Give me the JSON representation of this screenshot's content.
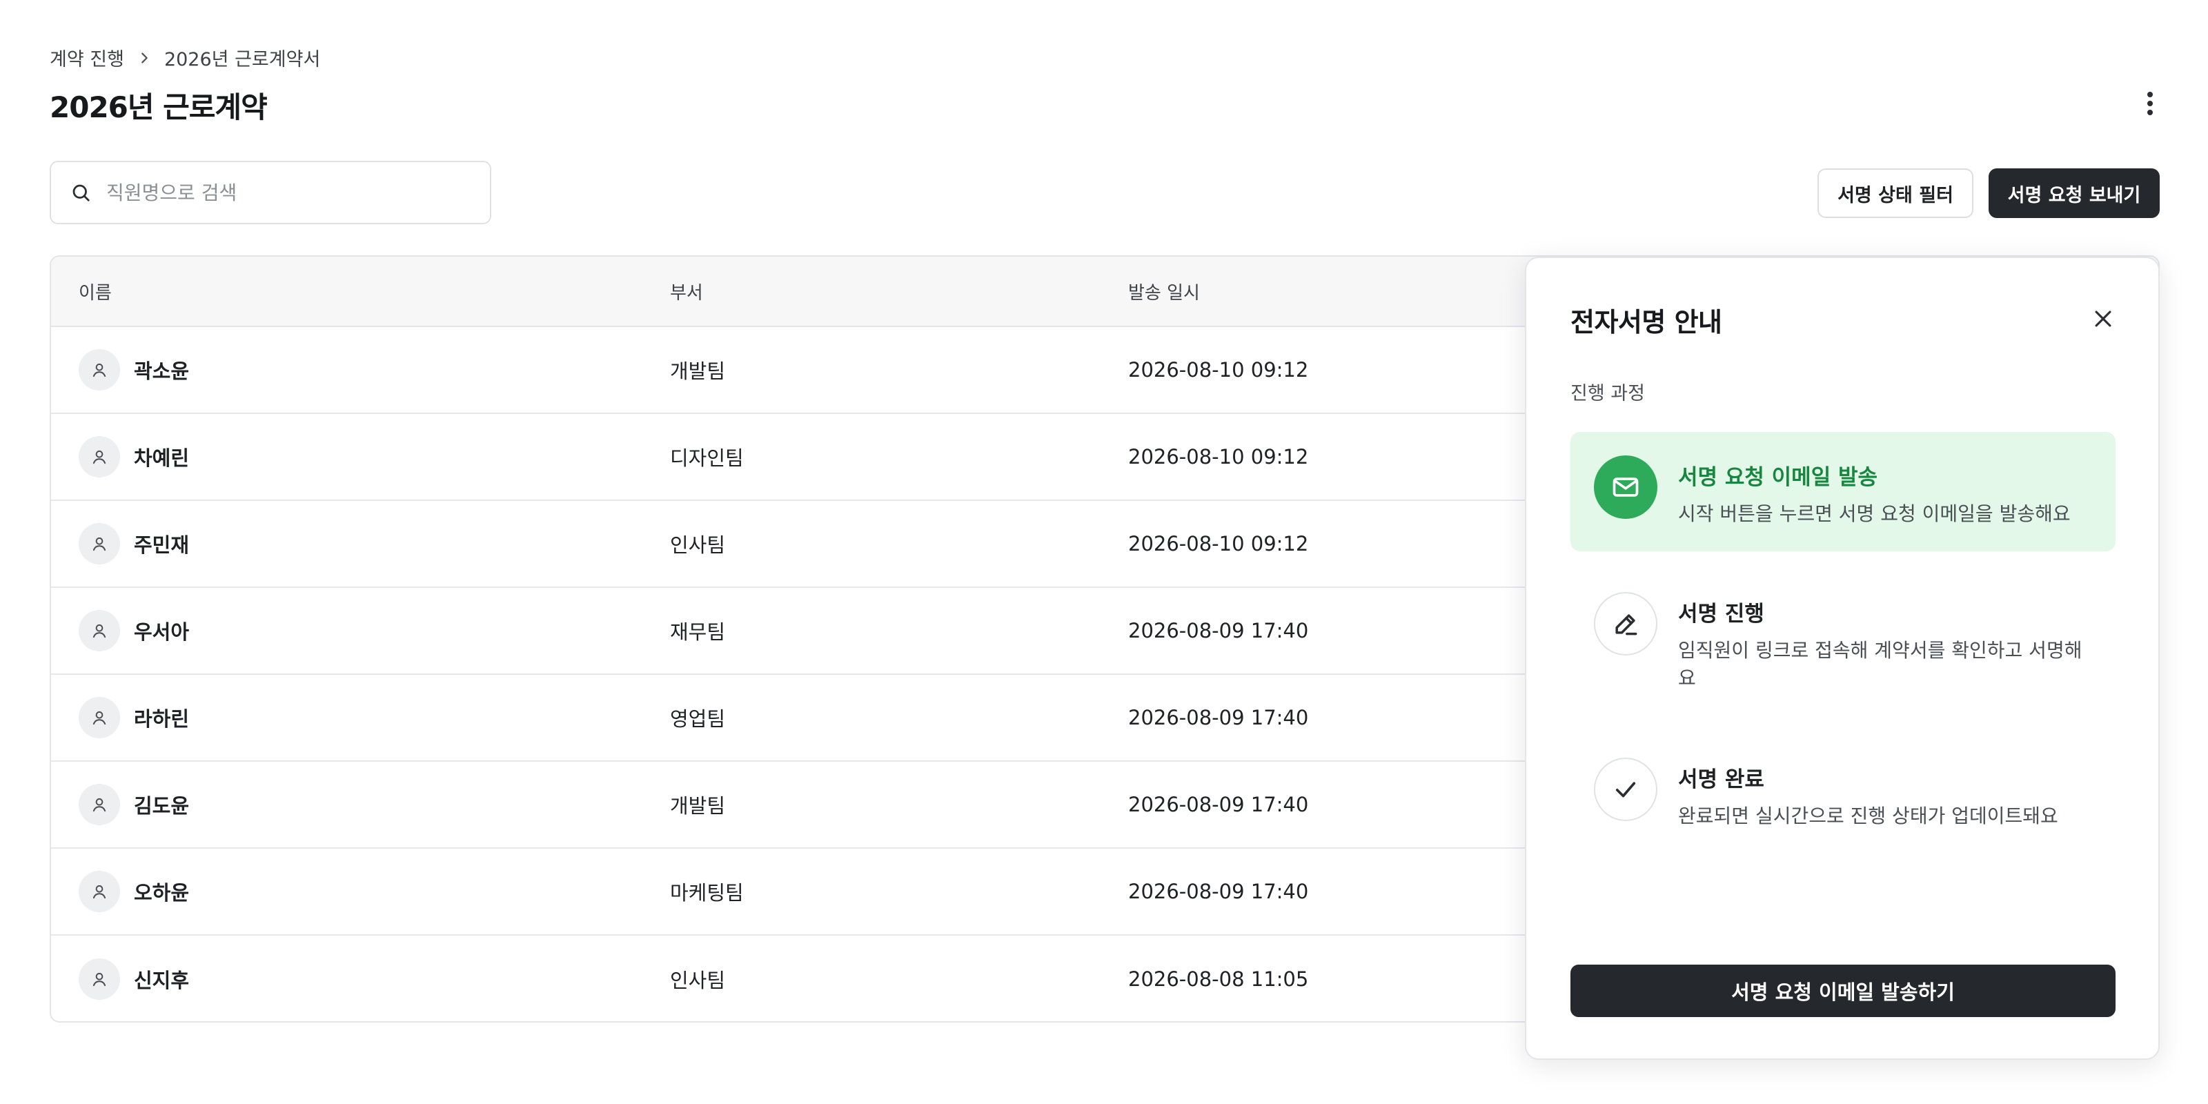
{
  "breadcrumb": {
    "items": [
      "계약 진행",
      "2026년 근로계약서"
    ]
  },
  "page": {
    "title": "2026년 근로계약"
  },
  "search": {
    "placeholder": "직원명으로 검색"
  },
  "actions": {
    "filter_label": "서명 상태 필터",
    "send_label": "서명 요청 보내기"
  },
  "table": {
    "columns": [
      "이름",
      "부서",
      "발송 일시"
    ],
    "rows": [
      {
        "name": "곽소윤",
        "dept": "개발팀",
        "sent_at": "2026-08-10 09:12"
      },
      {
        "name": "차예린",
        "dept": "디자인팀",
        "sent_at": "2026-08-10 09:12"
      },
      {
        "name": "주민재",
        "dept": "인사팀",
        "sent_at": "2026-08-10 09:12"
      },
      {
        "name": "우서아",
        "dept": "재무팀",
        "sent_at": "2026-08-09 17:40"
      },
      {
        "name": "라하린",
        "dept": "영업팀",
        "sent_at": "2026-08-09 17:40"
      },
      {
        "name": "김도윤",
        "dept": "개발팀",
        "sent_at": "2026-08-09 17:40"
      },
      {
        "name": "오하윤",
        "dept": "마케팅팀",
        "sent_at": "2026-08-09 17:40"
      },
      {
        "name": "신지후",
        "dept": "인사팀",
        "sent_at": "2026-08-08 11:05"
      }
    ]
  },
  "panel": {
    "title": "전자서명 안내",
    "subtitle": "진행 과정",
    "steps": [
      {
        "icon": "mail-icon",
        "title": "서명 요청 이메일 발송",
        "desc": "시작 버튼을 누르면 서명 요청 이메일을 발송해요",
        "active": true
      },
      {
        "icon": "pen-icon",
        "title": "서명 진행",
        "desc": "임직원이 링크로 접속해 계약서를 확인하고 서명해요",
        "active": false
      },
      {
        "icon": "check-icon",
        "title": "서명 완료",
        "desc": "완료되면 실시간으로 진행 상태가 업데이트돼요",
        "active": false
      }
    ],
    "cta_label": "서명 요청 이메일 발송하기"
  },
  "colors": {
    "primary_dark": "#25282c",
    "active_green": "#2eaa5b",
    "active_bg": "#e3f8e8",
    "active_text": "#17863f"
  }
}
